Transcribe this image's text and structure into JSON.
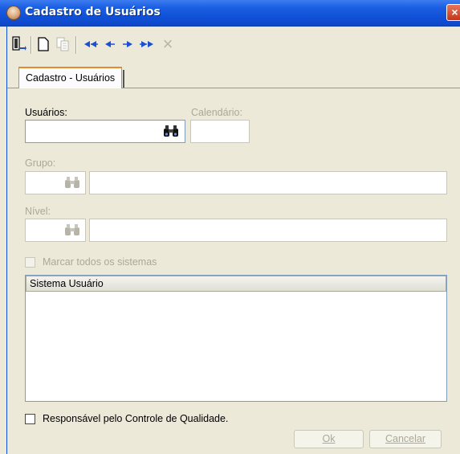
{
  "window": {
    "title": "Cadastro de Usuários",
    "close_glyph": "×"
  },
  "toolbar": {
    "icons": [
      "exit-door-icon",
      "new-document-icon",
      "copy-document-icon",
      "first-record-icon",
      "previous-record-icon",
      "next-record-icon",
      "last-record-icon",
      "delete-icon"
    ],
    "delete_glyph": "×"
  },
  "tabs": [
    {
      "label": "Cadastro - Usuários",
      "active": true
    }
  ],
  "form": {
    "usuarios_label": "Usuários:",
    "usuarios_value": "",
    "calendario_label": "Calendário:",
    "calendario_value": "",
    "grupo_label": "Grupo:",
    "grupo_code": "",
    "grupo_desc": "",
    "nivel_label": "Nível:",
    "nivel_code": "",
    "nivel_desc": "",
    "marcar_todos_label": "Marcar todos os sistemas",
    "marcar_todos_checked": false,
    "responsavel_label": "Responsável pelo Controle de Qualidade.",
    "responsavel_checked": false
  },
  "grid": {
    "columns": [
      "Sistema Usuário"
    ],
    "rows": []
  },
  "buttons": {
    "ok_label": "Ok",
    "cancel_label": "Cancelar"
  },
  "colors": {
    "titlebar": "#0f4fd6",
    "window_bg": "#ece9d8",
    "tab_accent": "#e68b2c",
    "nav_arrow": "#1f4fd1"
  }
}
